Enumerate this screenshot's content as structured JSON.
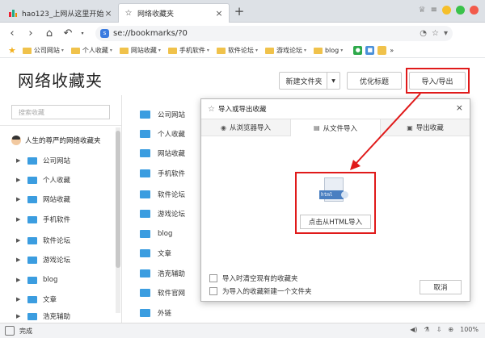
{
  "tabs": [
    {
      "title": "hao123_上网从这里开始",
      "active": false
    },
    {
      "title": "网络收藏夹",
      "active": true
    }
  ],
  "new_tab_label": "+",
  "address_bar": {
    "url": "se://bookmarks/?0"
  },
  "bookmarks_bar": [
    {
      "label": "公司网站"
    },
    {
      "label": "个人收藏"
    },
    {
      "label": "网站收藏"
    },
    {
      "label": "手机软件"
    },
    {
      "label": "软件论坛"
    },
    {
      "label": "游戏论坛"
    },
    {
      "label": "blog"
    }
  ],
  "page": {
    "title": "网络收藏夹",
    "new_folder_label": "新建文件夹",
    "optimize_label": "优化标题",
    "import_export_label": "导入/导出",
    "search_placeholder": "搜索收藏"
  },
  "sidebar": {
    "root_label": "人生的尊严的网络收藏夹",
    "items": [
      {
        "label": "公司网站"
      },
      {
        "label": "个人收藏"
      },
      {
        "label": "网站收藏"
      },
      {
        "label": "手机软件"
      },
      {
        "label": "软件论坛"
      },
      {
        "label": "游戏论坛"
      },
      {
        "label": "blog"
      },
      {
        "label": "文章"
      },
      {
        "label": "浩克辅助"
      }
    ]
  },
  "main_list": [
    {
      "label": "公司网站"
    },
    {
      "label": "个人收藏"
    },
    {
      "label": "网站收藏"
    },
    {
      "label": "手机软件"
    },
    {
      "label": "软件论坛"
    },
    {
      "label": "游戏论坛"
    },
    {
      "label": "blog"
    },
    {
      "label": "文章"
    },
    {
      "label": "浩克辅助"
    },
    {
      "label": "软件官网"
    },
    {
      "label": "外链"
    }
  ],
  "dialog": {
    "title": "导入或导出收藏",
    "tabs": [
      {
        "label": "从浏览器导入"
      },
      {
        "label": "从文件导入"
      },
      {
        "label": "导出收藏"
      }
    ],
    "file_tag": "html",
    "html_import_label": "点击从HTML导入",
    "checkbox_clear": "导入时清空现有的收藏夹",
    "checkbox_newfolder": "为导入的收藏新建一个文件夹",
    "cancel_label": "取消"
  },
  "status_bar": {
    "status": "完成",
    "zoom": "100%"
  },
  "colors": {
    "accent_red": "#e01a1a",
    "folder_blue": "#3b9de0",
    "folder_yellow": "#f0c24b"
  }
}
